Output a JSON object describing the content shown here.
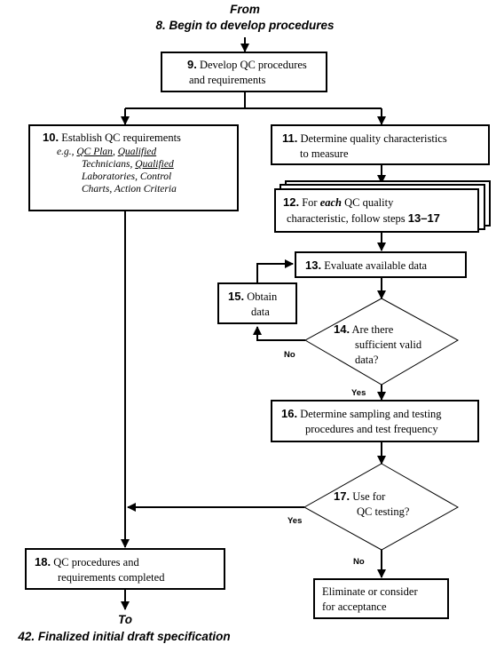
{
  "header": {
    "from_label": "From",
    "from_step": "8. Begin to develop procedures"
  },
  "footer": {
    "to_label": "To",
    "to_step": "42. Finalized initial draft specification"
  },
  "steps": {
    "s9": {
      "num": "9.",
      "line1": "Develop QC procedures",
      "line2": "and requirements"
    },
    "s10": {
      "num": "10.",
      "title": "Establish QC requirements",
      "eg": "e.g.,",
      "examples": [
        "QC Plan",
        "Qualified Technicians",
        "Qualified Laboratories",
        "Control Charts",
        "Action Criteria"
      ],
      "l1a": "QC Plan",
      "l1b": ", ",
      "l1c": "Qualified",
      "l2a": "Technicians",
      "l2b": ", ",
      "l2c": "Qualified",
      "l3a": "Laboratories",
      "l3b": ", ",
      "l3c": "Control",
      "l4a": "Charts",
      "l4b": ", ",
      "l4c": "Action Criteria"
    },
    "s11": {
      "num": "11.",
      "line1": "Determine quality characteristics",
      "line2": "to measure"
    },
    "s12": {
      "num": "12.",
      "pre": "For ",
      "each": "each",
      "post": " QC quality",
      "line2": "characteristic, follow steps ",
      "range": "13–17"
    },
    "s13": {
      "num": "13.",
      "line1": "Evaluate available data"
    },
    "s14": {
      "num": "14.",
      "line1": "Are there",
      "line2": "sufficient valid",
      "line3": "data?"
    },
    "s15": {
      "num": "15.",
      "line1": "Obtain",
      "line2": "data"
    },
    "s16": {
      "num": "16.",
      "line1": "Determine sampling and testing",
      "line2": "procedures and test frequency"
    },
    "s17": {
      "num": "17.",
      "line1": "Use for",
      "line2": "QC testing?"
    },
    "s18": {
      "num": "18.",
      "line1": "QC procedures and",
      "line2": "requirements completed"
    },
    "elim": {
      "line1": "Eliminate or consider",
      "line2": "for acceptance"
    }
  },
  "edge_labels": {
    "s14_no": "No",
    "s14_yes": "Yes",
    "s17_yes": "Yes",
    "s17_no": "No"
  }
}
